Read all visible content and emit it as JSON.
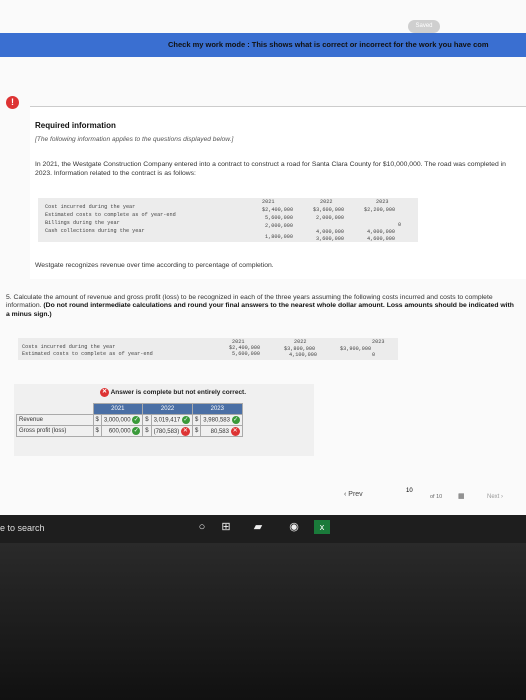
{
  "header": {
    "saved": "Saved",
    "banner": "Check my work mode : This shows what is correct or incorrect for the work you have com"
  },
  "alert_icon": "!",
  "required": {
    "heading": "Required information",
    "subheading": "[The following information applies to the questions displayed below.]",
    "intro": "In 2021, the Westgate Construction Company entered into a contract to construct a road for Santa Clara County for $10,000,000. The road was completed in 2023. Information related to the contract is as follows:",
    "table": {
      "years": [
        "2021",
        "2022",
        "2023"
      ],
      "rows": [
        {
          "label": "Cost incurred during the year",
          "values": [
            "$2,400,000",
            "$3,600,000",
            "$2,200,000"
          ]
        },
        {
          "label": "Estimated costs to complete as of year-end",
          "values": [
            "5,600,000",
            "2,000,000",
            "0"
          ]
        },
        {
          "label": "Billings during the year",
          "values": [
            "2,000,000",
            "4,000,000",
            "4,000,000"
          ]
        },
        {
          "label": "Cash collections during the year",
          "values": [
            "1,800,000",
            "3,600,000",
            "4,600,000"
          ]
        }
      ]
    },
    "recognition": "Westgate recognizes revenue over time according to percentage of completion."
  },
  "question": {
    "text": "5. Calculate the amount of revenue and gross profit (loss) to be recognized in each of the three years assuming the following costs incurred and costs to complete information.",
    "bold": "(Do not round intermediate calculations and round your final answers to the nearest whole dollar amount. Loss amounts should be indicated with a minus sign.)",
    "table": {
      "years": [
        "2021",
        "2022",
        "2023"
      ],
      "rows": [
        {
          "label": "Costs incurred during the year",
          "values": [
            "$2,400,000",
            "$3,800,000",
            "$3,900,000"
          ]
        },
        {
          "label": "Estimated costs to complete as of year-end",
          "values": [
            "5,600,000",
            "4,100,000",
            "0"
          ]
        }
      ]
    }
  },
  "answer": {
    "status": "Answer is complete but not entirely correct.",
    "years": [
      "2021",
      "2022",
      "2023"
    ],
    "rows": [
      {
        "label": "Revenue",
        "cells": [
          "$",
          "3,000,000",
          "$",
          "3,019,417",
          "$",
          "3,980,583"
        ]
      },
      {
        "label": "Gross profit (loss)",
        "cells": [
          "$",
          "600,000",
          "$",
          "(780,583)",
          "$",
          "80,583"
        ]
      }
    ]
  },
  "nav": {
    "prev": "Prev",
    "page": "10",
    "of": "of 10",
    "next": "Next"
  },
  "taskbar": {
    "search": "e to search"
  },
  "colors": {
    "banner": "#3a6fd1",
    "correct": "#3a9a3a",
    "wrong": "#d33333"
  }
}
